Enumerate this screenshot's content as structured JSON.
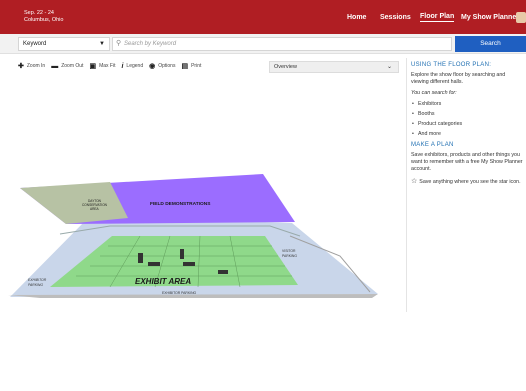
{
  "event": {
    "dates": "Sep. 22 - 24",
    "location": "Columbus, Ohio"
  },
  "nav": {
    "home": "Home",
    "sessions": "Sessions",
    "floor_plan": "Floor Plan",
    "my_show_planner": "My Show Planner"
  },
  "search": {
    "scope": "Keyword",
    "placeholder": "Search by Keyword",
    "button": "Search"
  },
  "toolbar": {
    "zoom_in": "Zoom In",
    "zoom_out": "Zoom Out",
    "max_fit": "Max Fit",
    "legend": "Legend",
    "options": "Options",
    "print": "Print",
    "view_select": "Overview"
  },
  "map": {
    "labels": {
      "dayton": "DAYTON",
      "conservation": "CONSERVATION",
      "area": "AREA",
      "field_demonstrations": "FIELD DEMONSTRATIONS",
      "exhibit_area": "EXHIBIT AREA",
      "exhibitor_parking": "EXHIBITOR PARKING",
      "exhibitor": "EXHIBITOR",
      "parking": "PARKING",
      "visitor": "VISITOR"
    },
    "colors": {
      "field": "#9b6dff",
      "exhibit": "#8fd98a",
      "grounds": "#c9d6ea",
      "road": "#d9d9d9"
    }
  },
  "sidebar": {
    "heading": "USING THE FLOOR PLAN:",
    "intro_line1": "Explore the show floor by searching and",
    "intro_line2": "viewing different halls.",
    "search_for": "You can search for:",
    "items": [
      "Exhibitors",
      "Booths",
      "Product categories",
      "And more"
    ],
    "plan_heading": "MAKE A PLAN",
    "plan_line1": "Save exhibitors, products and other things you",
    "plan_line2": "want to remember with a free My Show Planner",
    "plan_line3": "account.",
    "star_note": "Save anything where you see the star icon."
  }
}
